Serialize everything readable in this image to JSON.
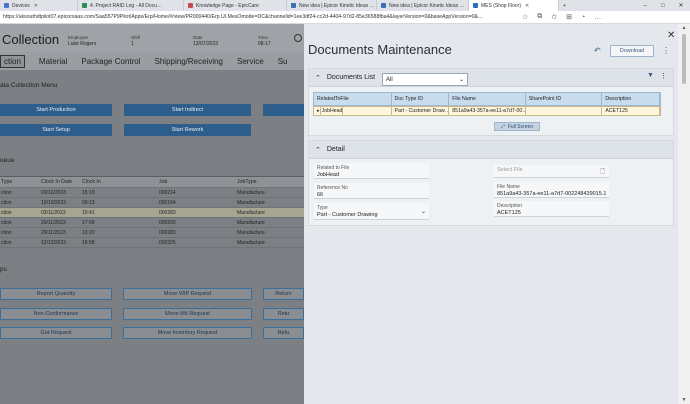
{
  "browser": {
    "tabs": [
      {
        "label": "Devices",
        "color": "#4a74c9"
      },
      {
        "label": "4. Project RAID Log - All Docu…",
        "color": "#2f8c4e"
      },
      {
        "label": "Knowledge Page - EpicCare",
        "color": "#c94a4a"
      },
      {
        "label": "New idea | Epicor Kinetic Ideas …",
        "color": "#3a6fb5"
      },
      {
        "label": "New idea | Epicor Kinetic Ideas …",
        "color": "#3a6fb5"
      },
      {
        "label": "MES (Shop Floor)",
        "color": "#2a6fb8"
      }
    ],
    "new_tab": "+",
    "minimize": "–",
    "maximize": "□",
    "close": "✕",
    "url": "https://uksouthdtpilot07.epicorsaas.com/Saa557P9Pilot/Apps/Erp/Home/#/view/PR000440/Erp.UI.MesOmode=DC&channelid=1ee3df24-cc2d-4404-97d2-85e36588fba4&layerVersion=0&baseAppVersion=0&…"
  },
  "left_app": {
    "title": "Collection",
    "employee_label": "Employee",
    "employee_value": "Luke Rogers",
    "shift_label": "Shift",
    "shift_value": "1",
    "date_label": "Date",
    "date_value": "13/07/2023",
    "time_label": "Time",
    "time_value": "08:17",
    "nav": [
      "ction",
      "Material",
      "Package Control",
      "Shipping/Receiving",
      "Service",
      "Su"
    ],
    "menu_title": "ata Collection Menu",
    "menu_buttons": [
      "Start Production",
      "Start Indirect",
      "",
      "Start Setup",
      "Start Rework"
    ],
    "queue_title": "ueue",
    "queue_columns": [
      "Type",
      "Clock In Date",
      "Clock In",
      "Job",
      "JobType"
    ],
    "queue_rows": [
      [
        "ction",
        "03/10/2023",
        "15:19",
        "000214",
        "Manufacture"
      ],
      [
        "ction",
        "19/10/2023",
        "09:13",
        "000164",
        "Manufacture"
      ],
      [
        "ction",
        "03/11/2023",
        "10:41",
        "000283",
        "Manufacture"
      ],
      [
        "ction",
        "20/11/2023",
        "17:09",
        "000293",
        "Manufacture"
      ],
      [
        "ction",
        "29/11/2023",
        "13:20",
        "000283",
        "Manufacture"
      ],
      [
        "ction",
        "12/12/2023",
        "16:58",
        "000325",
        "Manufacture"
      ]
    ],
    "selected_row": 2,
    "steps_title": "ps",
    "steps_buttons": [
      "Report Quantity",
      "Move WIP Request",
      "Return",
      "Non-Conformance",
      "Move MtI Request",
      "Retu",
      "Get Request",
      "Move Inventory Request",
      "Retu"
    ]
  },
  "panel": {
    "title": "Documents Maintenance",
    "download_label": "Download",
    "documents_list": {
      "title": "Documents List",
      "filter_value": "All",
      "columns": [
        "RelatedToFile",
        "Doc Type ID",
        "File Name",
        "SharePoint ID",
        "Description"
      ],
      "rows": [
        [
          "JobHead",
          "Part - Customer Draw…",
          "851a9a43-357a-ee11-a7d7-00…",
          "",
          "ACET125"
        ]
      ],
      "full_screen_label": "Full Screen"
    },
    "detail": {
      "title": "Detail",
      "related_to_file_label": "Related to File",
      "related_to_file_value": "JobHead",
      "reference_no_label": "Reference No",
      "reference_no_value": "66",
      "type_label": "Type",
      "type_value": "Part - Customer Drawing",
      "select_file_placeholder": "Select File",
      "file_name_label": "File Name",
      "file_name_value": "851a9a43-357a-ee11-a7d7-002248439015.163",
      "description_label": "Description",
      "description_value": "ACET125"
    }
  }
}
